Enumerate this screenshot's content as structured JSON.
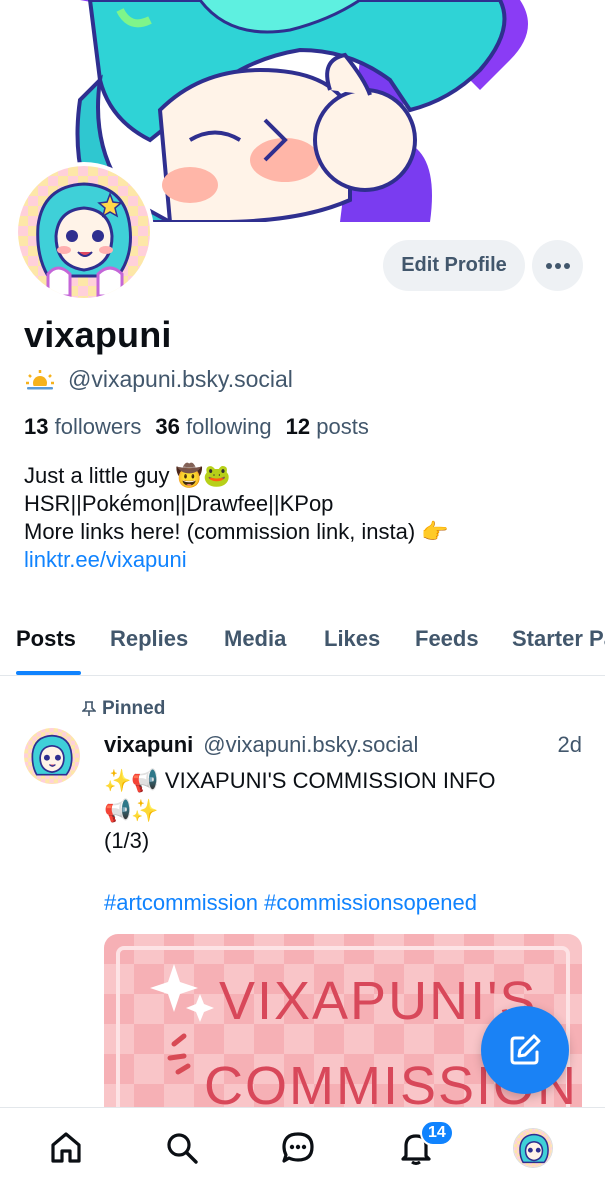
{
  "profile": {
    "display_name": "vixapuni",
    "handle": "@vixapuni.bsky.social",
    "handle_icon": "sun-emoji-icon",
    "followers_count": "13",
    "followers_label": "followers",
    "following_count": "36",
    "following_label": "following",
    "posts_count": "12",
    "posts_label": "posts",
    "bio_line1": "Just a little guy 🤠🐸",
    "bio_line2": "HSR||Pokémon||Drawfee||KPop",
    "bio_line3": "More links here! (commission link, insta) 👉",
    "bio_link": "linktr.ee/vixapuni"
  },
  "actions": {
    "edit_profile_label": "Edit Profile",
    "more_icon": "ellipsis-icon"
  },
  "tabs": [
    {
      "label": "Posts",
      "active": true
    },
    {
      "label": "Replies"
    },
    {
      "label": "Media"
    },
    {
      "label": "Likes"
    },
    {
      "label": "Feeds"
    },
    {
      "label": "Starter Packs"
    }
  ],
  "post": {
    "pinned_label": "Pinned",
    "author_name": "vixapuni",
    "author_handle": "@vixapuni.bsky.social",
    "time": "2d",
    "text_line1": "✨📢 VIXAPUNI'S COMMISSION INFO",
    "text_line2": "📢✨",
    "text_line3": "(1/3)",
    "hashtags": "#artcommission #commissionsopened",
    "image_text_line1": "VIXAPUNI'S",
    "image_text_line2": "COMMISSION"
  },
  "bottom_nav": {
    "items": [
      "home-icon",
      "search-icon",
      "chat-icon",
      "notifications-icon",
      "profile-avatar"
    ],
    "notification_count": "14"
  },
  "colors": {
    "accent": "#1083fe",
    "muted_text": "#42576c",
    "button_bg": "#eef1f4"
  }
}
